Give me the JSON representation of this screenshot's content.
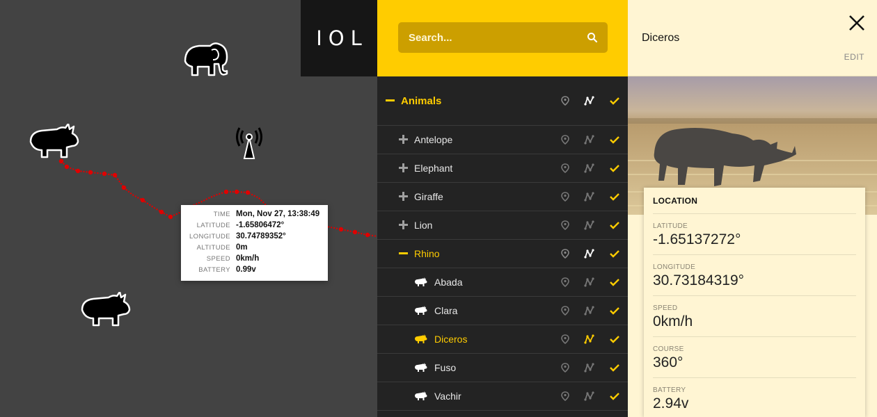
{
  "app": {
    "logo": "IOL"
  },
  "search": {
    "placeholder": "Search..."
  },
  "map": {
    "markers": [
      {
        "type": "elephant",
        "icon": "elephant-icon"
      },
      {
        "type": "rhino",
        "icon": "rhino-icon"
      },
      {
        "type": "antenna",
        "icon": "antenna-icon"
      },
      {
        "type": "rhino",
        "icon": "rhino-icon"
      }
    ],
    "track_color": "#e00000",
    "tooltip": {
      "time_label": "TIME",
      "time": "Mon, Nov 27, 13:38:49",
      "lat_label": "LATITUDE",
      "lat": "-1.65806472°",
      "lon_label": "LONGITUDE",
      "lon": "30.74789352°",
      "alt_label": "ALTITUDE",
      "alt": "0m",
      "speed_label": "SPEED",
      "speed": "0km/h",
      "battery_label": "BATTERY",
      "battery": "0.99v"
    }
  },
  "list": {
    "group": {
      "label": "Animals"
    },
    "categories": [
      {
        "label": "Antelope"
      },
      {
        "label": "Elephant"
      },
      {
        "label": "Giraffe"
      },
      {
        "label": "Lion"
      },
      {
        "label": "Rhino"
      }
    ],
    "rhinos": [
      {
        "label": "Abada"
      },
      {
        "label": "Clara"
      },
      {
        "label": "Diceros"
      },
      {
        "label": "Fuso"
      },
      {
        "label": "Vachir"
      }
    ]
  },
  "detail": {
    "title": "Diceros",
    "edit": "EDIT",
    "card_title": "LOCATION",
    "fields": [
      {
        "label": "LATITUDE",
        "value": "-1.65137272°"
      },
      {
        "label": "LONGITUDE",
        "value": "30.73184319°"
      },
      {
        "label": "SPEED",
        "value": "0km/h"
      },
      {
        "label": "COURSE",
        "value": "360°"
      },
      {
        "label": "BATTERY",
        "value": "2.94v"
      }
    ]
  },
  "colors": {
    "accent": "#ffcc00",
    "panel": "#232323",
    "map": "#434343",
    "detail": "#fff5d3"
  }
}
